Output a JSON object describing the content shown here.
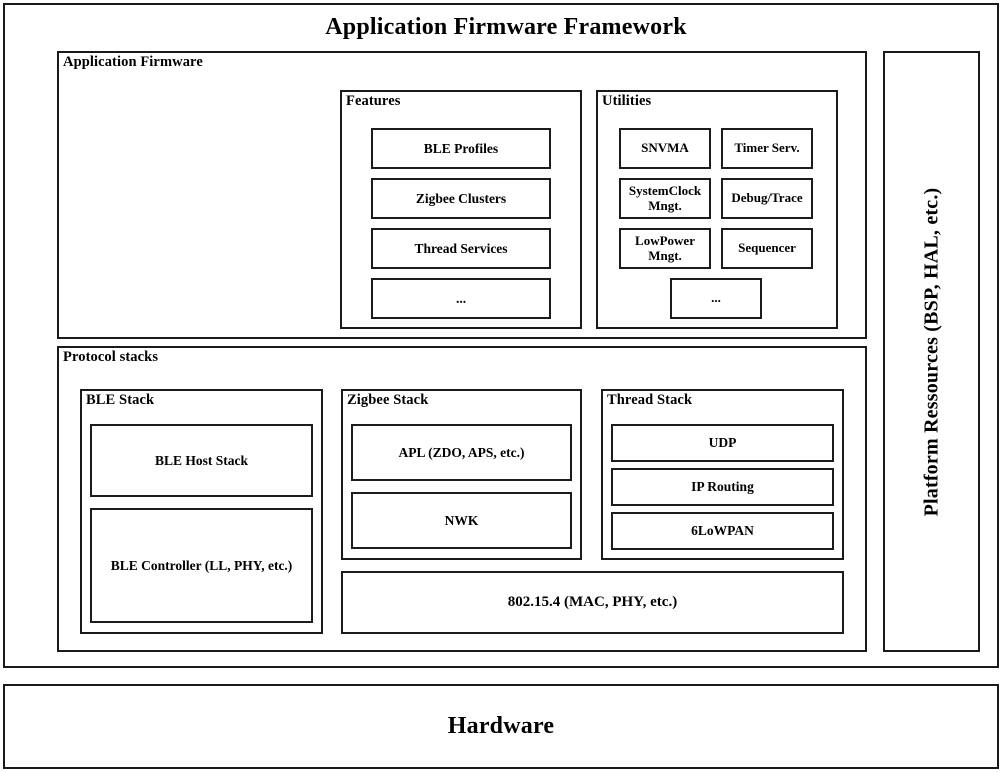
{
  "diagram": {
    "title": "Application Firmware Framework",
    "hardware": "Hardware",
    "platform_resources": "Platform Ressources (BSP, HAL, etc.)",
    "app_firmware": {
      "label": "Application Firmware",
      "features": {
        "label": "Features",
        "items": [
          "BLE Profiles",
          "Zigbee Clusters",
          "Thread Services",
          "..."
        ]
      },
      "utilities": {
        "label": "Utilities",
        "items": [
          "SNVMA",
          "Timer Serv.",
          "SystemClock Mngt.",
          "Debug/Trace",
          "LowPower Mngt.",
          "Sequencer"
        ],
        "ellipsis": "..."
      }
    },
    "protocol_stacks": {
      "label": "Protocol stacks",
      "ble_stack": {
        "label": "BLE Stack",
        "items": [
          "BLE Host Stack",
          "BLE Controller (LL, PHY, etc.)"
        ]
      },
      "zigbee_stack": {
        "label": "Zigbee Stack",
        "items": [
          "APL (ZDO, APS, etc.)",
          "NWK"
        ]
      },
      "thread_stack": {
        "label": "Thread Stack",
        "items": [
          "UDP",
          "IP Routing",
          "6LoWPAN"
        ]
      },
      "radio": "802.15.4 (MAC, PHY,  etc.)"
    },
    "colors": {
      "border": "#1a1a1a",
      "background": "#ffffff",
      "text": "#000000"
    }
  }
}
